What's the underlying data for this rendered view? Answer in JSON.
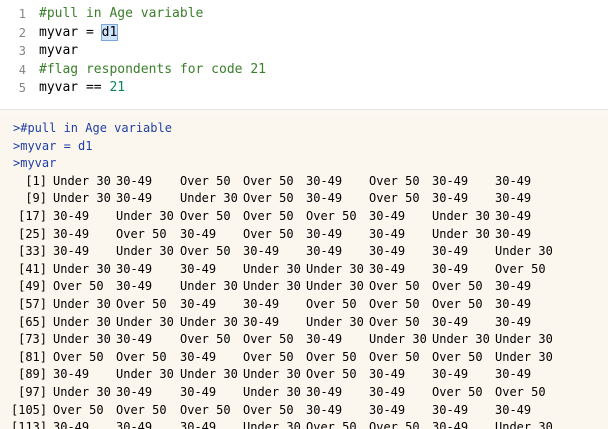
{
  "editor": {
    "lines": [
      {
        "num": "1",
        "parts": [
          {
            "t": "#pull in Age variable",
            "c": "comment"
          }
        ]
      },
      {
        "num": "2",
        "parts": [
          {
            "t": "myvar = ",
            "c": ""
          },
          {
            "t": "d1",
            "c": "sel"
          }
        ]
      },
      {
        "num": "3",
        "parts": [
          {
            "t": "myvar",
            "c": ""
          }
        ]
      },
      {
        "num": "4",
        "parts": [
          {
            "t": "#flag respondents for code 21",
            "c": "comment"
          }
        ]
      },
      {
        "num": "5",
        "parts": [
          {
            "t": "myvar == ",
            "c": ""
          },
          {
            "t": "21",
            "c": "num"
          }
        ]
      }
    ]
  },
  "console": {
    "echo": [
      ">#pull in Age variable",
      ">myvar = d1",
      ">myvar"
    ],
    "rows": [
      {
        "idx": "[1]",
        "values": [
          "Under 30",
          "30-49",
          "Over 50",
          "Over 50",
          "30-49",
          "Over 50",
          "30-49",
          "30-49"
        ]
      },
      {
        "idx": "[9]",
        "values": [
          "Under 30",
          "30-49",
          "Under 30",
          "Over 50",
          "30-49",
          "Over 50",
          "30-49",
          "30-49"
        ]
      },
      {
        "idx": "[17]",
        "values": [
          "30-49",
          "Under 30",
          "Over 50",
          "Over 50",
          "Over 50",
          "30-49",
          "Under 30",
          "30-49"
        ]
      },
      {
        "idx": "[25]",
        "values": [
          "30-49",
          "Over 50",
          "30-49",
          "Over 50",
          "30-49",
          "30-49",
          "Under 30",
          "30-49"
        ]
      },
      {
        "idx": "[33]",
        "values": [
          "30-49",
          "Under 30",
          "Over 50",
          "30-49",
          "30-49",
          "30-49",
          "30-49",
          "Under 30"
        ]
      },
      {
        "idx": "[41]",
        "values": [
          "Under 30",
          "30-49",
          "30-49",
          "Under 30",
          "Under 30",
          "30-49",
          "30-49",
          "Over 50"
        ]
      },
      {
        "idx": "[49]",
        "values": [
          "Over 50",
          "30-49",
          "Under 30",
          "Under 30",
          "Under 30",
          "Over 50",
          "Over 50",
          "30-49"
        ]
      },
      {
        "idx": "[57]",
        "values": [
          "Under 30",
          "Over 50",
          "30-49",
          "30-49",
          "Over 50",
          "Over 50",
          "Over 50",
          "30-49"
        ]
      },
      {
        "idx": "[65]",
        "values": [
          "Under 30",
          "Under 30",
          "Under 30",
          "30-49",
          "Under 30",
          "Over 50",
          "30-49",
          "30-49"
        ]
      },
      {
        "idx": "[73]",
        "values": [
          "Under 30",
          "30-49",
          "Over 50",
          "Over 50",
          "30-49",
          "Under 30",
          "Under 30",
          "Under 30"
        ]
      },
      {
        "idx": "[81]",
        "values": [
          "Over 50",
          "Over 50",
          "30-49",
          "Over 50",
          "Over 50",
          "Over 50",
          "Over 50",
          "Under 30"
        ]
      },
      {
        "idx": "[89]",
        "values": [
          "30-49",
          "Under 30",
          "Under 30",
          "Under 30",
          "Over 50",
          "30-49",
          "30-49",
          "30-49"
        ]
      },
      {
        "idx": "[97]",
        "values": [
          "Under 30",
          "30-49",
          "30-49",
          "Under 30",
          "30-49",
          "30-49",
          "Over 50",
          "Over 50"
        ]
      },
      {
        "idx": "[105]",
        "values": [
          "Over 50",
          "Over 50",
          "Over 50",
          "Over 50",
          "30-49",
          "30-49",
          "30-49",
          "30-49"
        ]
      },
      {
        "idx": "[113]",
        "values": [
          "30-49",
          "30-49",
          "30-49",
          "Under 30",
          "Over 50",
          "Over 50",
          "30-49",
          "Under 30"
        ]
      }
    ]
  },
  "colors": {
    "comment": "#3a7f2a",
    "echo": "#1f3fa5",
    "console_bg": "#fcf7ee",
    "selection": "#cfe3fb",
    "number": "#098658"
  }
}
